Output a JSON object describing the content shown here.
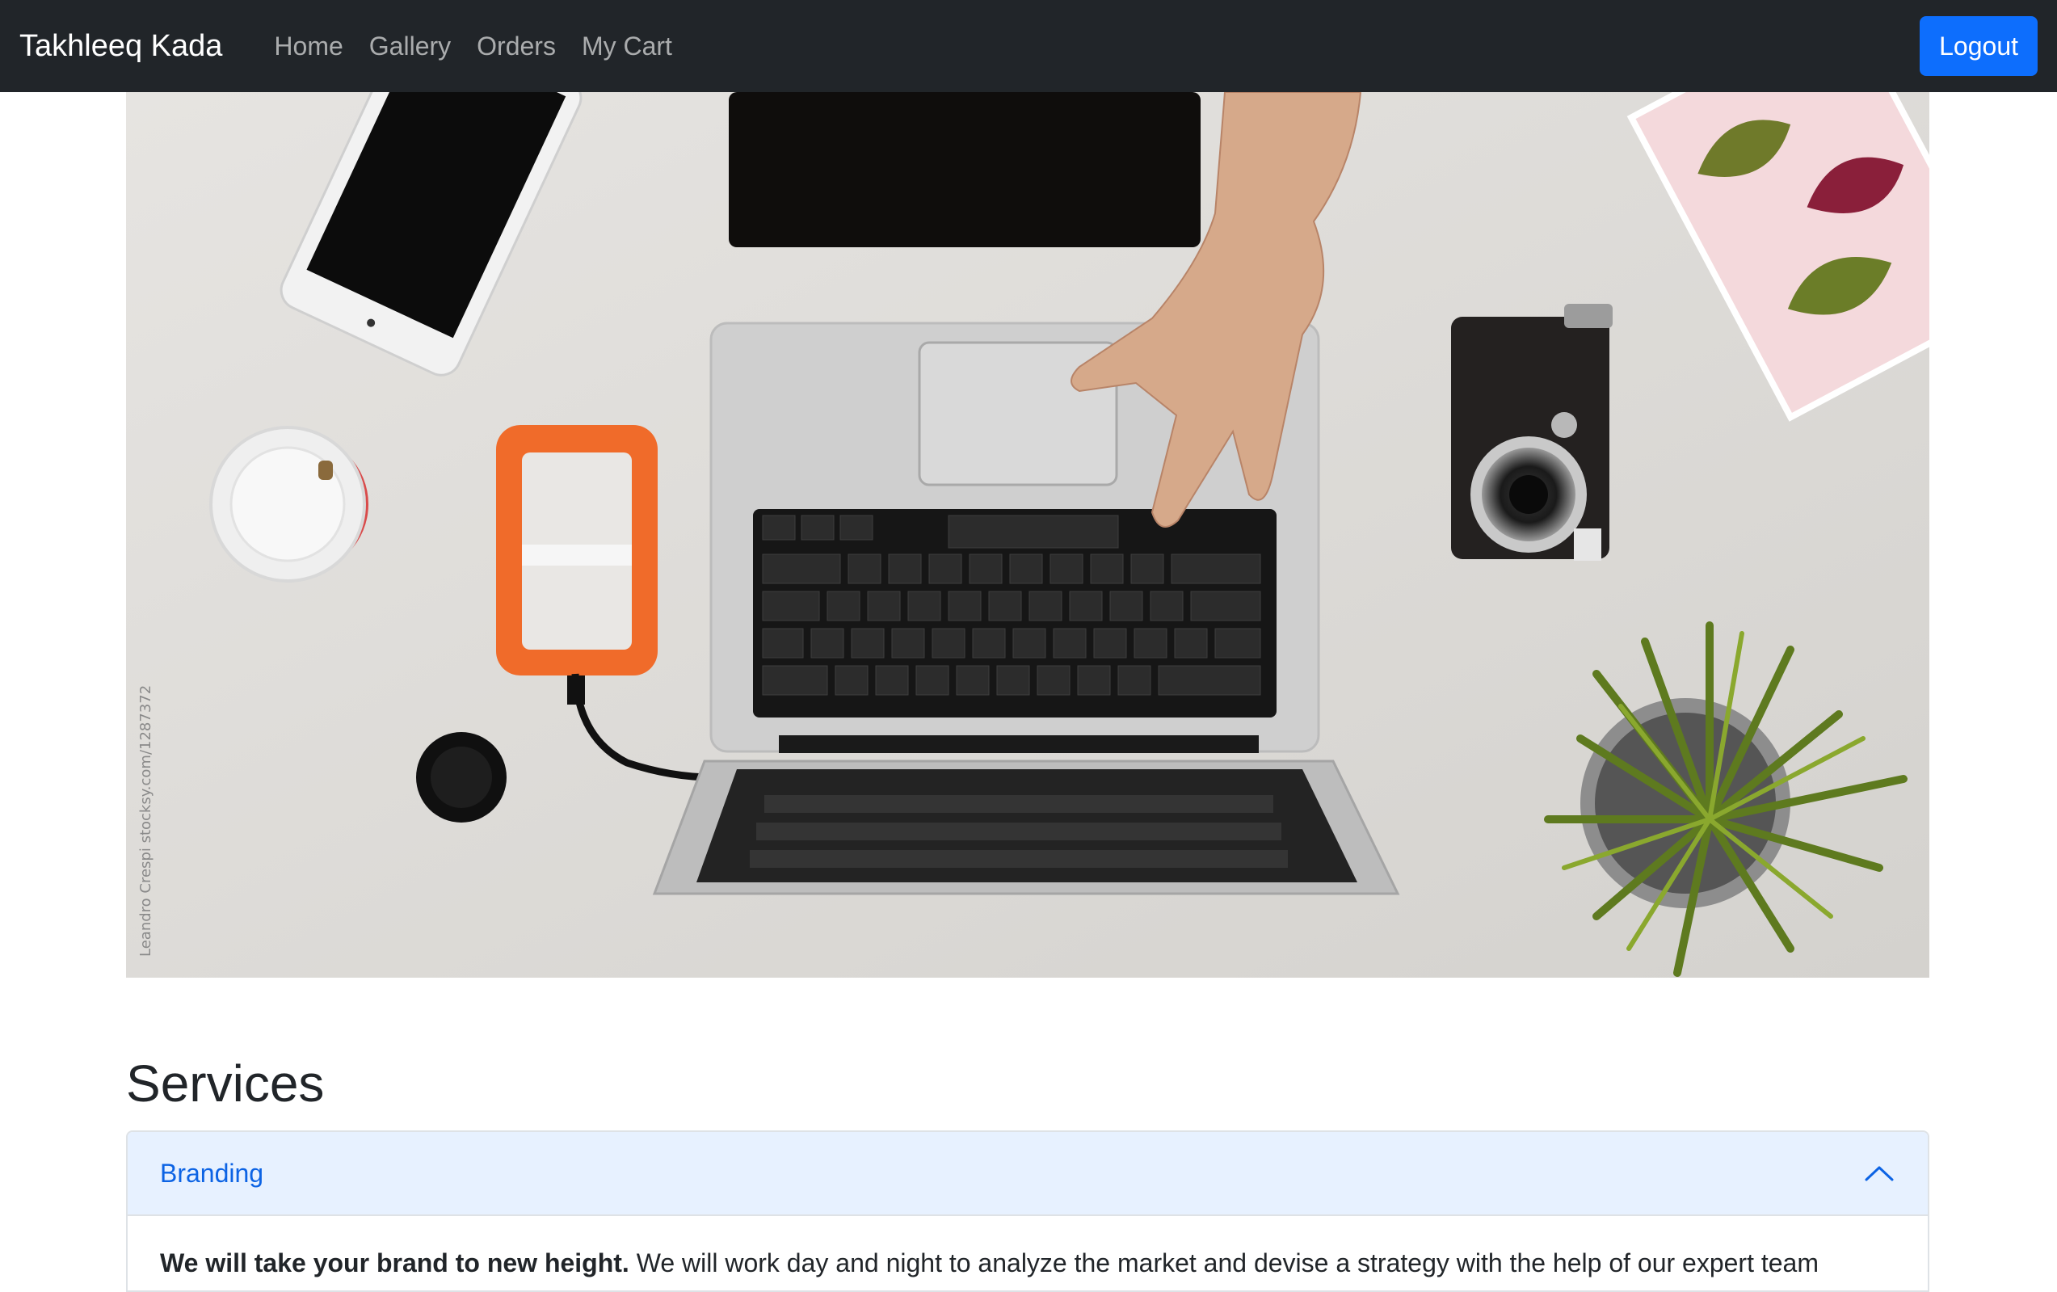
{
  "navbar": {
    "brand": "Takhleeq Kada",
    "links": [
      "Home",
      "Gallery",
      "Orders",
      "My Cart"
    ],
    "logout_label": "Logout"
  },
  "hero": {
    "watermark_credit": "Leandro Crespi stocksy.com/1287372"
  },
  "services": {
    "title": "Services",
    "accordion": [
      {
        "title": "Branding",
        "expanded": true,
        "body_bold": "We will take your brand to new height.",
        "body_text": " We will work day and night to analyze the market and devise a strategy with the help of our expert team"
      }
    ]
  },
  "colors": {
    "navbar_bg": "#212529",
    "primary": "#0d6efd",
    "accordion_active_bg": "#e7f1ff",
    "accordion_active_text": "#0c63e4"
  }
}
